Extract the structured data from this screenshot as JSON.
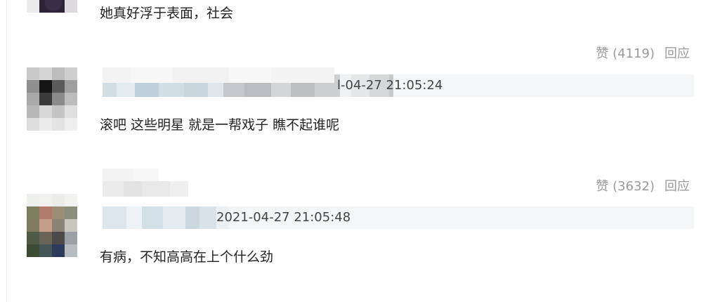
{
  "comments": [
    {
      "text": "她真好浮于表面，社会",
      "like_label": "赞 (4119)",
      "reply_label": "回应"
    },
    {
      "timestamp": "l-04-27 21:05:24",
      "text": "滚吧 这些明星 就是一帮戏子 瞧不起谁呢",
      "like_label": "赞 (3632)",
      "reply_label": "回应"
    },
    {
      "timestamp": "2021-04-27 21:05:48",
      "text": "有病，不知高高在上个什么劲"
    }
  ]
}
